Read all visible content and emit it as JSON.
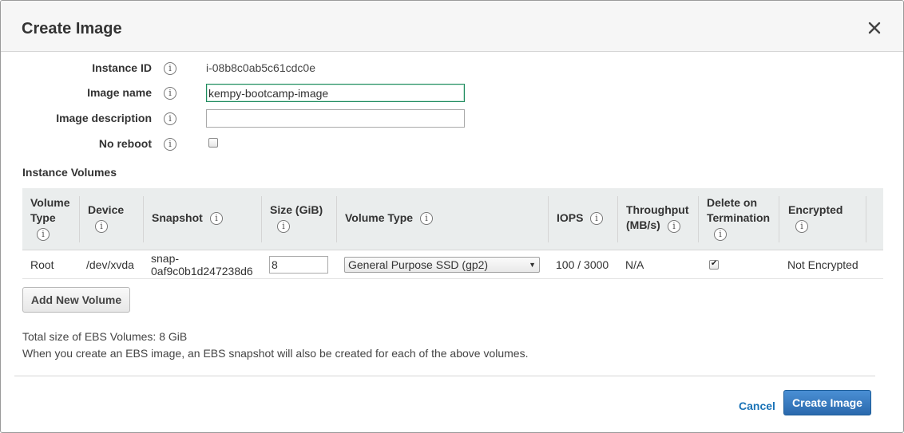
{
  "dialog": {
    "title": "Create Image",
    "close_icon": "close-icon"
  },
  "form": {
    "instance_id": {
      "label": "Instance ID",
      "value": "i-08b8c0ab5c61cdc0e"
    },
    "image_name": {
      "label": "Image name",
      "value": "kempy-bootcamp-image"
    },
    "image_description": {
      "label": "Image description",
      "value": ""
    },
    "no_reboot": {
      "label": "No reboot",
      "checked": false
    },
    "info_glyph": "i"
  },
  "volumes": {
    "title": "Instance Volumes",
    "columns": {
      "volume_type_line1": "Volume",
      "volume_type_line2": "Type",
      "device": "Device",
      "snapshot": "Snapshot",
      "size": "Size (GiB)",
      "volume_type": "Volume Type",
      "iops": "IOPS",
      "throughput_line1": "Throughput",
      "throughput_line2": "(MB/s)",
      "delete_line1": "Delete on",
      "delete_line2": "Termination",
      "encrypted": "Encrypted"
    },
    "rows": [
      {
        "volume_type": "Root",
        "device": "/dev/xvda",
        "snapshot_line1": "snap-",
        "snapshot_line2": "0af9c0b1d247238d6",
        "size": "8",
        "ebs_type": "General Purpose SSD (gp2)",
        "iops": "100 / 3000",
        "throughput": "N/A",
        "delete_on_termination": true,
        "encrypted": "Not Encrypted"
      }
    ],
    "add_button": "Add New Volume"
  },
  "footer": {
    "total_size": "Total size of EBS Volumes: 8 GiB",
    "note": "When you create an EBS image, an EBS snapshot will also be created for each of the above volumes.",
    "cancel_label": "Cancel",
    "create_label": "Create Image"
  },
  "colors": {
    "primary_button": "#2a69ad",
    "link": "#1a73b7",
    "header_bg": "#f6f6f6",
    "table_header_bg": "#eaeded",
    "focus_border": "#1e8a5e"
  }
}
